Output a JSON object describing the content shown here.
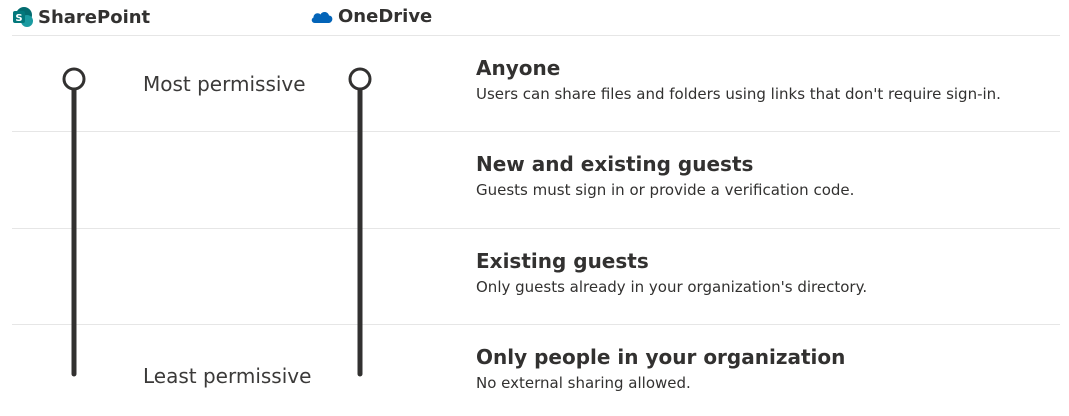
{
  "header": {
    "sharepoint": {
      "label": "SharePoint",
      "icon": "sharepoint-icon",
      "color": "#036c70"
    },
    "onedrive": {
      "label": "OneDrive",
      "icon": "onedrive-icon",
      "color": "#0364b8"
    }
  },
  "scale": {
    "most_label": "Most permissive",
    "least_label": "Least permissive"
  },
  "levels": [
    {
      "title": "Anyone",
      "description": "Users can share files and folders using links that don't require sign-in."
    },
    {
      "title": "New and existing guests",
      "description": "Guests must sign in or provide a verification code."
    },
    {
      "title": "Existing guests",
      "description": "Only guests already in your organization's directory."
    },
    {
      "title": "Only people in your organization",
      "description": "No external sharing allowed."
    }
  ],
  "colors": {
    "text": "#323130",
    "slider": "#323130",
    "divider": "#e6e6e6"
  }
}
